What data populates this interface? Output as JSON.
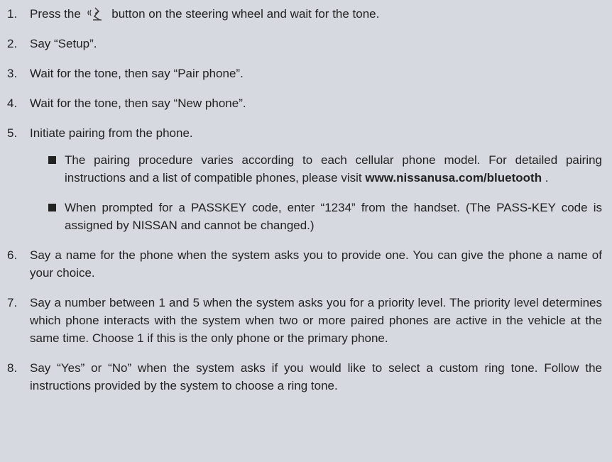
{
  "steps": [
    {
      "num": "1.",
      "before_icon": "Press the ",
      "icon": "talk-button-icon",
      "after_icon": " button on the steering wheel and wait for the tone."
    },
    {
      "num": "2.",
      "text": "Say “Setup”."
    },
    {
      "num": "3.",
      "text": "Wait for the tone, then say “Pair phone”."
    },
    {
      "num": "4.",
      "text": "Wait for the tone, then say “New phone”."
    },
    {
      "num": "5.",
      "text": "Initiate pairing from the phone."
    },
    {
      "num": "6.",
      "text": "Say a name for the phone when the system asks you to provide one. You can give the phone a name of your choice."
    },
    {
      "num": "7.",
      "text": "Say a number between 1 and 5 when the system asks you for a priority level. The priority level determines which phone interacts with the system when two or more paired phones are active in the vehicle at the same time. Choose 1 if this is the only phone or the primary phone."
    },
    {
      "num": "8.",
      "text": "Say “Yes” or “No” when the system asks if you would like to select a custom ring tone. Follow the instructions provided by the system to choose a ring tone."
    }
  ],
  "step5_bullets": [
    {
      "text": "The pairing procedure varies according to each cellular phone model. For detailed pairing instructions and a list of compatible phones, please visit ",
      "url": "www.nissanusa.com/bluetooth",
      "after": " ."
    },
    {
      "text": "When prompted for a PASSKEY code, enter “1234” from the handset. (The PASS-KEY code is assigned by NISSAN and cannot be changed.)"
    }
  ]
}
